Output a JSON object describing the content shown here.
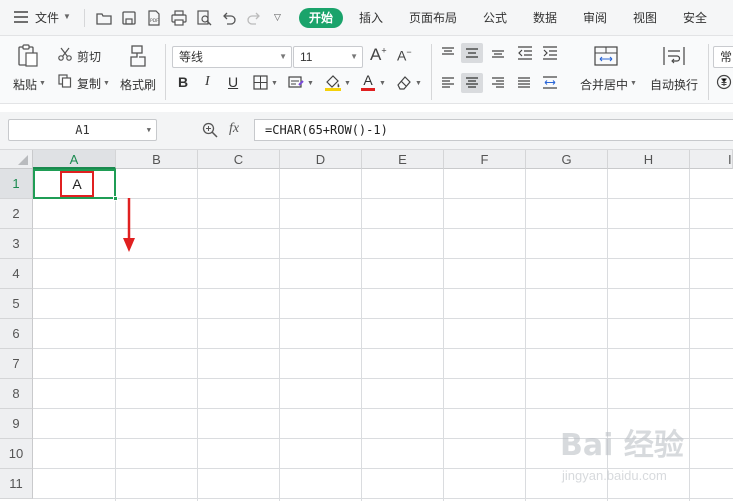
{
  "menubar": {
    "file_label": "文件",
    "tabs": [
      "开始",
      "插入",
      "页面布局",
      "公式",
      "数据",
      "审阅",
      "视图",
      "安全"
    ],
    "active_tab": "开始"
  },
  "ribbon": {
    "paste_label": "粘贴",
    "cut_label": "剪切",
    "copy_label": "复制",
    "format_painter_label": "格式刷",
    "font_name": "等线",
    "font_size": "11",
    "grow_font_label": "A",
    "shrink_font_label": "A",
    "bold_label": "B",
    "italic_label": "I",
    "underline_label": "U",
    "font_color_label": "A",
    "merge_center_label": "合并居中",
    "wrap_text_label": "自动换行",
    "number_format_partial": "常"
  },
  "formula_bar": {
    "name_box": "A1",
    "fx_label": "fx",
    "formula": "=CHAR(65+ROW()-1)"
  },
  "sheet": {
    "columns": [
      "A",
      "B",
      "C",
      "D",
      "E",
      "F",
      "G",
      "H",
      "I"
    ],
    "rows": [
      "1",
      "2",
      "3",
      "4",
      "5",
      "6",
      "7",
      "8",
      "9",
      "10",
      "11"
    ],
    "selected_cell": "A1",
    "cell_A1_value": "A"
  },
  "watermark": {
    "logo_text": "Bai 经验",
    "sub_text": "jingyan.baidu.com"
  },
  "colors": {
    "accent_green": "#1aa36b",
    "selection_green": "#1f9d55",
    "highlight_red": "#e02020"
  }
}
